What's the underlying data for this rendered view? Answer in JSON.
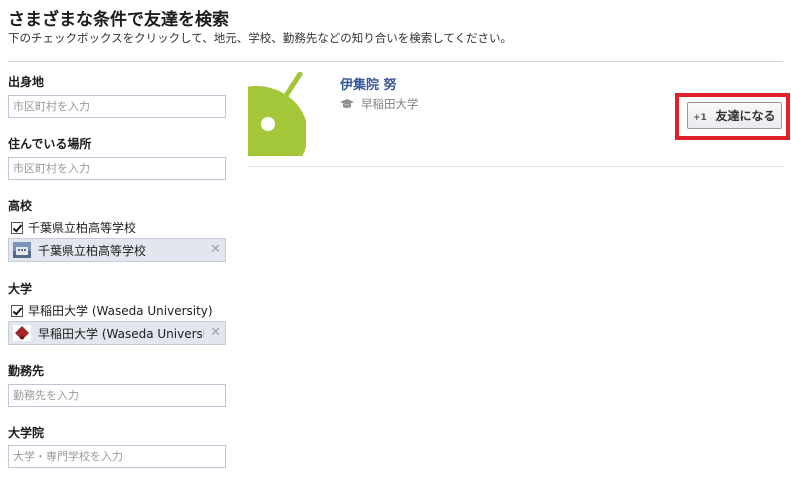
{
  "header": {
    "title": "さまざまな条件で友達を検索",
    "description": "下のチェックボックスをクリックして、地元、学校、勤務先などの知り合いを検索してください。"
  },
  "filters": {
    "hometown": {
      "label": "出身地",
      "placeholder": "市区町村を入力"
    },
    "current_city": {
      "label": "住んでいる場所",
      "placeholder": "市区町村を入力"
    },
    "high_school": {
      "label": "高校",
      "checkbox_label": "千葉県立柏高等学校",
      "checked": true,
      "token_text": "千葉県立柏高等学校",
      "token_icon": "school-building-icon"
    },
    "university": {
      "label": "大学",
      "checkbox_label": "早稲田大学 (Waseda University)",
      "checked": true,
      "token_text": "早稲田大学 (Waseda University",
      "token_icon": "waseda-emblem-icon"
    },
    "employer": {
      "label": "勤務先",
      "placeholder": "勤務先を入力"
    },
    "grad_school": {
      "label": "大学院",
      "placeholder": "大学・専門学校を入力"
    },
    "remove_symbol": "✕"
  },
  "result": {
    "name": "伊集院 努",
    "school": "早稲田大学",
    "school_icon": "graduation-cap-icon",
    "avatar_icon": "android-avatar",
    "add_friend_label": "友達になる",
    "add_friend_icon": "add-friend-icon"
  },
  "colors": {
    "link": "#3b5998",
    "highlight": "#e0202a",
    "avatar_green": "#a4c639",
    "token_bg": "#e2e6ee"
  }
}
